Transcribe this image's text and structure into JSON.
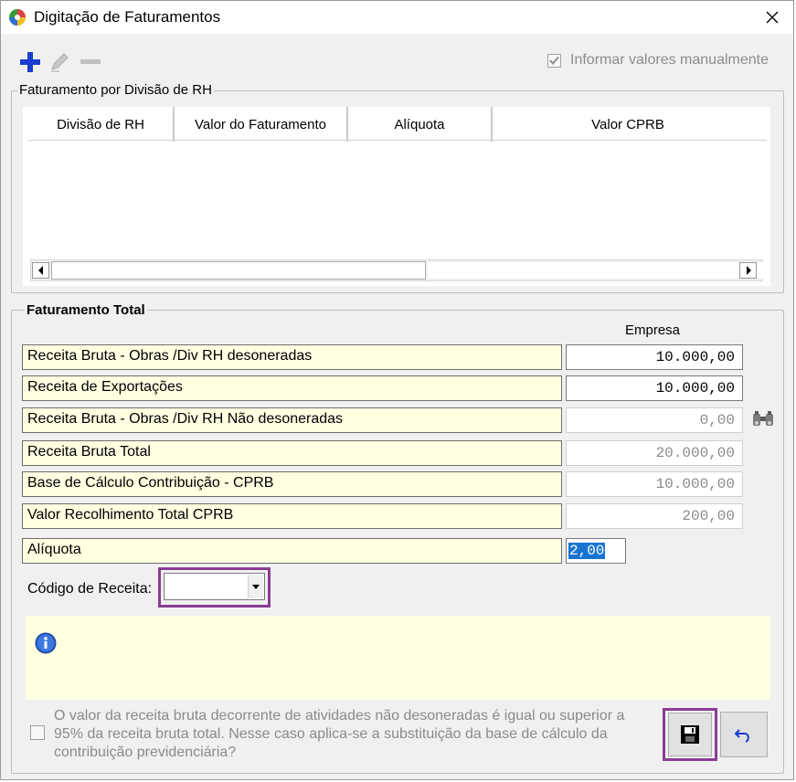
{
  "window": {
    "title": "Digitação de Faturamentos"
  },
  "toolbar": {
    "add_icon": "plus-icon",
    "edit_icon": "pencil-icon",
    "remove_icon": "minus-icon"
  },
  "manual": {
    "label": "Informar valores manualmente",
    "checked": true
  },
  "division_group": {
    "legend": "Faturamento por Divisão de RH",
    "columns": [
      "Divisão de RH",
      "Valor do Faturamento",
      "Alíquota",
      "Valor CPRB"
    ]
  },
  "total_group": {
    "legend": "Faturamento Total",
    "column_header": "Empresa",
    "rows": [
      {
        "label": "Receita Bruta - Obras /Div RH desoneradas",
        "value": "10.000,00"
      },
      {
        "label": "Receita de Exportações",
        "value": "10.000,00"
      },
      {
        "label": "Receita Bruta - Obras /Div RH Não desoneradas",
        "value": "0,00"
      },
      {
        "label": "Receita Bruta Total",
        "value": "20.000,00"
      },
      {
        "label": "Base de Cálculo Contribuição - CPRB",
        "value": "10.000,00"
      },
      {
        "label": "Valor Recolhimento Total CPRB",
        "value": "200,00"
      }
    ],
    "aliquota": {
      "label": "Alíquota",
      "value": "2,00"
    },
    "codigo": {
      "label": "Código de Receita:",
      "value": ""
    }
  },
  "bottom": {
    "question": "O valor da receita bruta decorrente de atividades não desoneradas é igual ou superior a 95% da receita bruta total. Nesse caso aplica-se a substituição da base de cálculo da contribuição previdenciária?"
  },
  "colors": {
    "highlight": "#8b3d93",
    "info_bg": "#ffffe1",
    "selection": "#1874d2",
    "accent_blue": "#1a3ccf"
  }
}
